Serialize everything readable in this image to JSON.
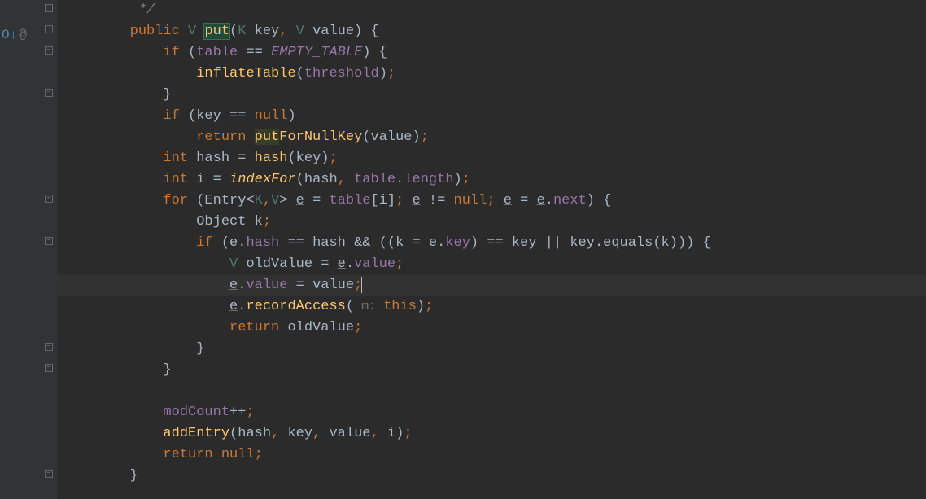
{
  "gutter": {
    "override_icon": "O↓",
    "impl_icon": "@"
  },
  "code": {
    "l0": "         */",
    "l1_public": "        public ",
    "l1_V": "V",
    "l1_sp": " ",
    "l1_put": "put",
    "l1_open": "(",
    "l1_K": "K",
    "l1_key": " key",
    "l1_c1": ", ",
    "l1_V2": "V",
    "l1_value": " value) {",
    "l2_if": "            if ",
    "l2_open": "(",
    "l2_table": "table",
    "l2_eq": " == ",
    "l2_empty": "EMPTY_TABLE",
    "l2_close": ") {",
    "l3_pre": "                ",
    "l3_inflate": "inflateTable",
    "l3_open": "(",
    "l3_thresh": "threshold",
    "l3_close": ")",
    "l3_semi": ";",
    "l4": "            }",
    "l5_if": "            if ",
    "l5_open": "(key == ",
    "l5_null": "null",
    "l5_close": ")",
    "l6_ret": "                return ",
    "l6_put": "put",
    "l6_fornull": "ForNullKey",
    "l6_open": "(value)",
    "l6_semi": ";",
    "l7_int": "            int ",
    "l7_hash": "hash = ",
    "l7_hashfn": "hash",
    "l7_args": "(key)",
    "l7_semi": ";",
    "l8_int": "            int ",
    "l8_i": "i = ",
    "l8_indexfor": "indexFor",
    "l8_open": "(hash",
    "l8_c": ", ",
    "l8_table": "table",
    "l8_dot": ".",
    "l8_length": "length",
    "l8_close": ")",
    "l8_semi": ";",
    "l9_for": "            for ",
    "l9_open": "(Entry<",
    "l9_K": "K",
    "l9_c1": ",",
    "l9_V": "V",
    "l9_close1": "> ",
    "l9_e1": "e",
    "l9_eq": " = ",
    "l9_table": "table",
    "l9_idx": "[i]",
    "l9_s1": "; ",
    "l9_e2": "e",
    "l9_neq": " != ",
    "l9_null": "null",
    "l9_s2": "; ",
    "l9_e3": "e",
    "l9_eq2": " = ",
    "l9_e4": "e",
    "l9_dot": ".",
    "l9_next": "next",
    "l9_close2": ") {",
    "l10_pre": "                Object k",
    "l10_semi": ";",
    "l11_if": "                if ",
    "l11_open": "(",
    "l11_e": "e",
    "l11_dot": ".",
    "l11_hash": "hash",
    "l11_eq": " == hash && ((k = ",
    "l11_e2": "e",
    "l11_dot2": ".",
    "l11_key": "key",
    "l11_rest": ") == key || key.equals(k))) {",
    "l12_pre": "                    ",
    "l12_V": "V",
    "l12_old": " oldValue = ",
    "l12_e": "e",
    "l12_dot": ".",
    "l12_value": "value",
    "l12_semi": ";",
    "l13_pre": "                    ",
    "l13_e": "e",
    "l13_dot": ".",
    "l13_value": "value",
    "l13_eq": " = value",
    "l13_semi": ";",
    "l14_pre": "                    ",
    "l14_e": "e",
    "l14_dot": ".",
    "l14_record": "recordAccess",
    "l14_open": "(",
    "l14_hint": " m: ",
    "l14_this": "this",
    "l14_close": ")",
    "l14_semi": ";",
    "l15_ret": "                    return ",
    "l15_old": "oldValue",
    "l15_semi": ";",
    "l16": "                }",
    "l17": "            }",
    "l18": "",
    "l19_pre": "            ",
    "l19_modcount": "modCount",
    "l19_pp": "++",
    "l19_semi": ";",
    "l20_pre": "            ",
    "l20_add": "addEntry",
    "l20_open": "(hash",
    "l20_c1": ", ",
    "l20_key": "key",
    "l20_c2": ", ",
    "l20_value": "value",
    "l20_c3": ", ",
    "l20_i": "i)",
    "l20_semi": ";",
    "l21_ret": "            return ",
    "l21_null": "null",
    "l21_semi": ";",
    "l22": "        }"
  }
}
